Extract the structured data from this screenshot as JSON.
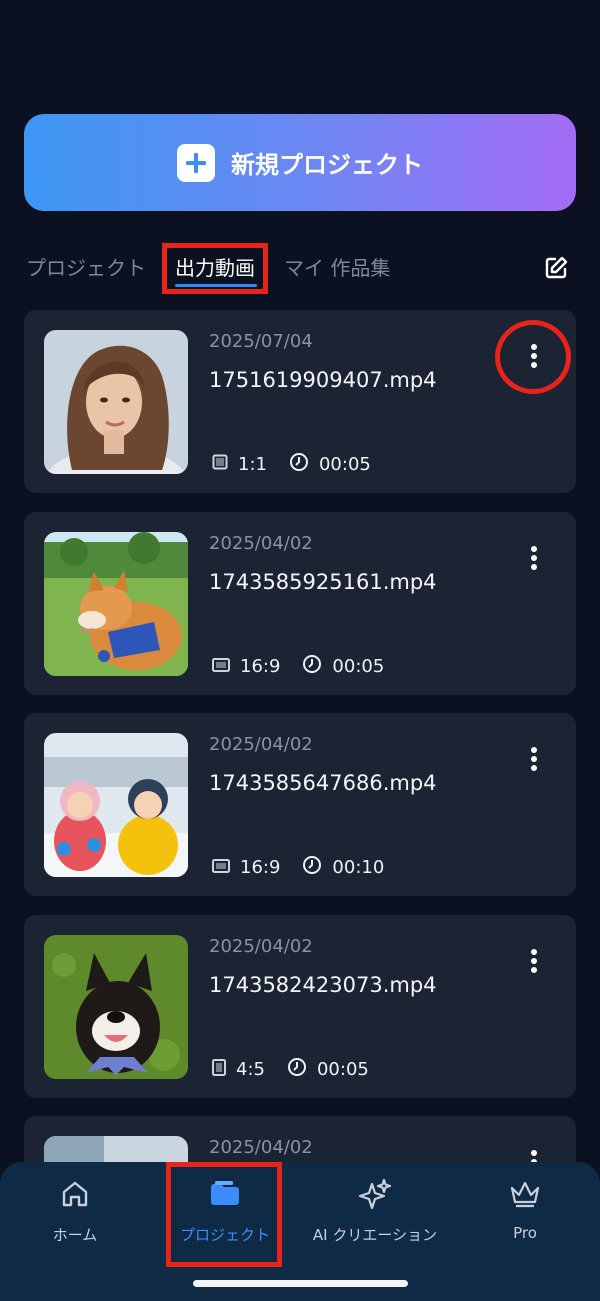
{
  "new_project": {
    "label": "新規プロジェクト",
    "icon": "plus-icon"
  },
  "tabs": [
    {
      "label": "プロジェクト",
      "active": false
    },
    {
      "label": "出力動画",
      "active": true
    },
    {
      "label": "マイ 作品集",
      "active": false
    }
  ],
  "edit_icon": "edit-icon",
  "videos": [
    {
      "date": "2025/07/04",
      "filename": "1751619909407.mp4",
      "aspect": "1:1",
      "duration": "00:05",
      "thumbnail": "woman-portrait"
    },
    {
      "date": "2025/04/02",
      "filename": "1743585925161.mp4",
      "aspect": "16:9",
      "duration": "00:05",
      "thumbnail": "shiba-dog-park"
    },
    {
      "date": "2025/04/02",
      "filename": "1743585647686.mp4",
      "aspect": "16:9",
      "duration": "00:10",
      "thumbnail": "kids-in-snow"
    },
    {
      "date": "2025/04/02",
      "filename": "1743582423073.mp4",
      "aspect": "4:5",
      "duration": "00:05",
      "thumbnail": "black-shiba-grass"
    },
    {
      "date": "2025/04/02",
      "filename": "",
      "aspect": "",
      "duration": "",
      "thumbnail": "partial"
    }
  ],
  "bottom_nav": [
    {
      "label": "ホーム",
      "icon": "home-icon",
      "active": false
    },
    {
      "label": "プロジェクト",
      "icon": "folder-icon",
      "active": true
    },
    {
      "label": "AI クリエーション",
      "icon": "sparkles-icon",
      "active": false
    },
    {
      "label": "Pro",
      "icon": "crown-icon",
      "active": false
    }
  ],
  "colors": {
    "background": "#0b1120",
    "card": "#1c2433",
    "accent": "#2f8cff",
    "highlight": "#e8231a",
    "nav": "#0f2a44"
  }
}
